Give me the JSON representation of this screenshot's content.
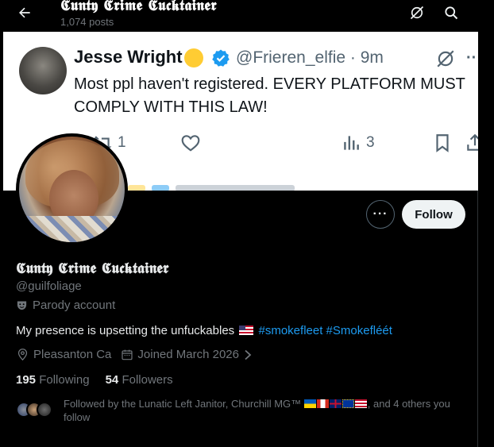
{
  "header": {
    "title": "𝕮𝖚𝖓𝖙𝖞 𝕮𝖗𝖎𝖒𝖊 𝕮𝖚𝖈𝖐𝖙𝖆𝖎𝖓𝖊𝖗",
    "posts_count": "1,074 posts"
  },
  "banner": {
    "author_name": "Jesse Wright",
    "author_handle": "@Frieren_elfie · 9m",
    "text": "Most ppl haven't  registered.  EVERY PLATFORM MUST COMPLY WITH THIS LAW!",
    "retweets": "1",
    "views": "3"
  },
  "profile": {
    "display_name": "𝕮𝖚𝖓𝖙𝖞 𝕮𝖗𝖎𝖒𝖊 𝕮𝖚𝖈𝖐𝖙𝖆𝖎𝖓𝖊𝖗",
    "handle": "@guilfoliage",
    "parody_label": "Parody account",
    "bio_text": "My presence is upsetting the unfuckables",
    "hashtag_1": "#smokefleet",
    "hashtag_2": "#Smokefléét",
    "location": "Pleasanton Ca",
    "joined": "Joined March 2026",
    "following_count": "195",
    "following_label": "Following",
    "followers_count": "54",
    "followers_label": "Followers",
    "followed_by_prefix": "Followed by the Lunatic Left Janitor, Churchill MG™",
    "followed_by_suffix": ", and 4 others you follow"
  },
  "actions": {
    "follow_label": "Follow",
    "more_label": "···"
  },
  "colors": {
    "accent": "#1d9bf0",
    "background": "#000000",
    "muted": "#71767b"
  }
}
